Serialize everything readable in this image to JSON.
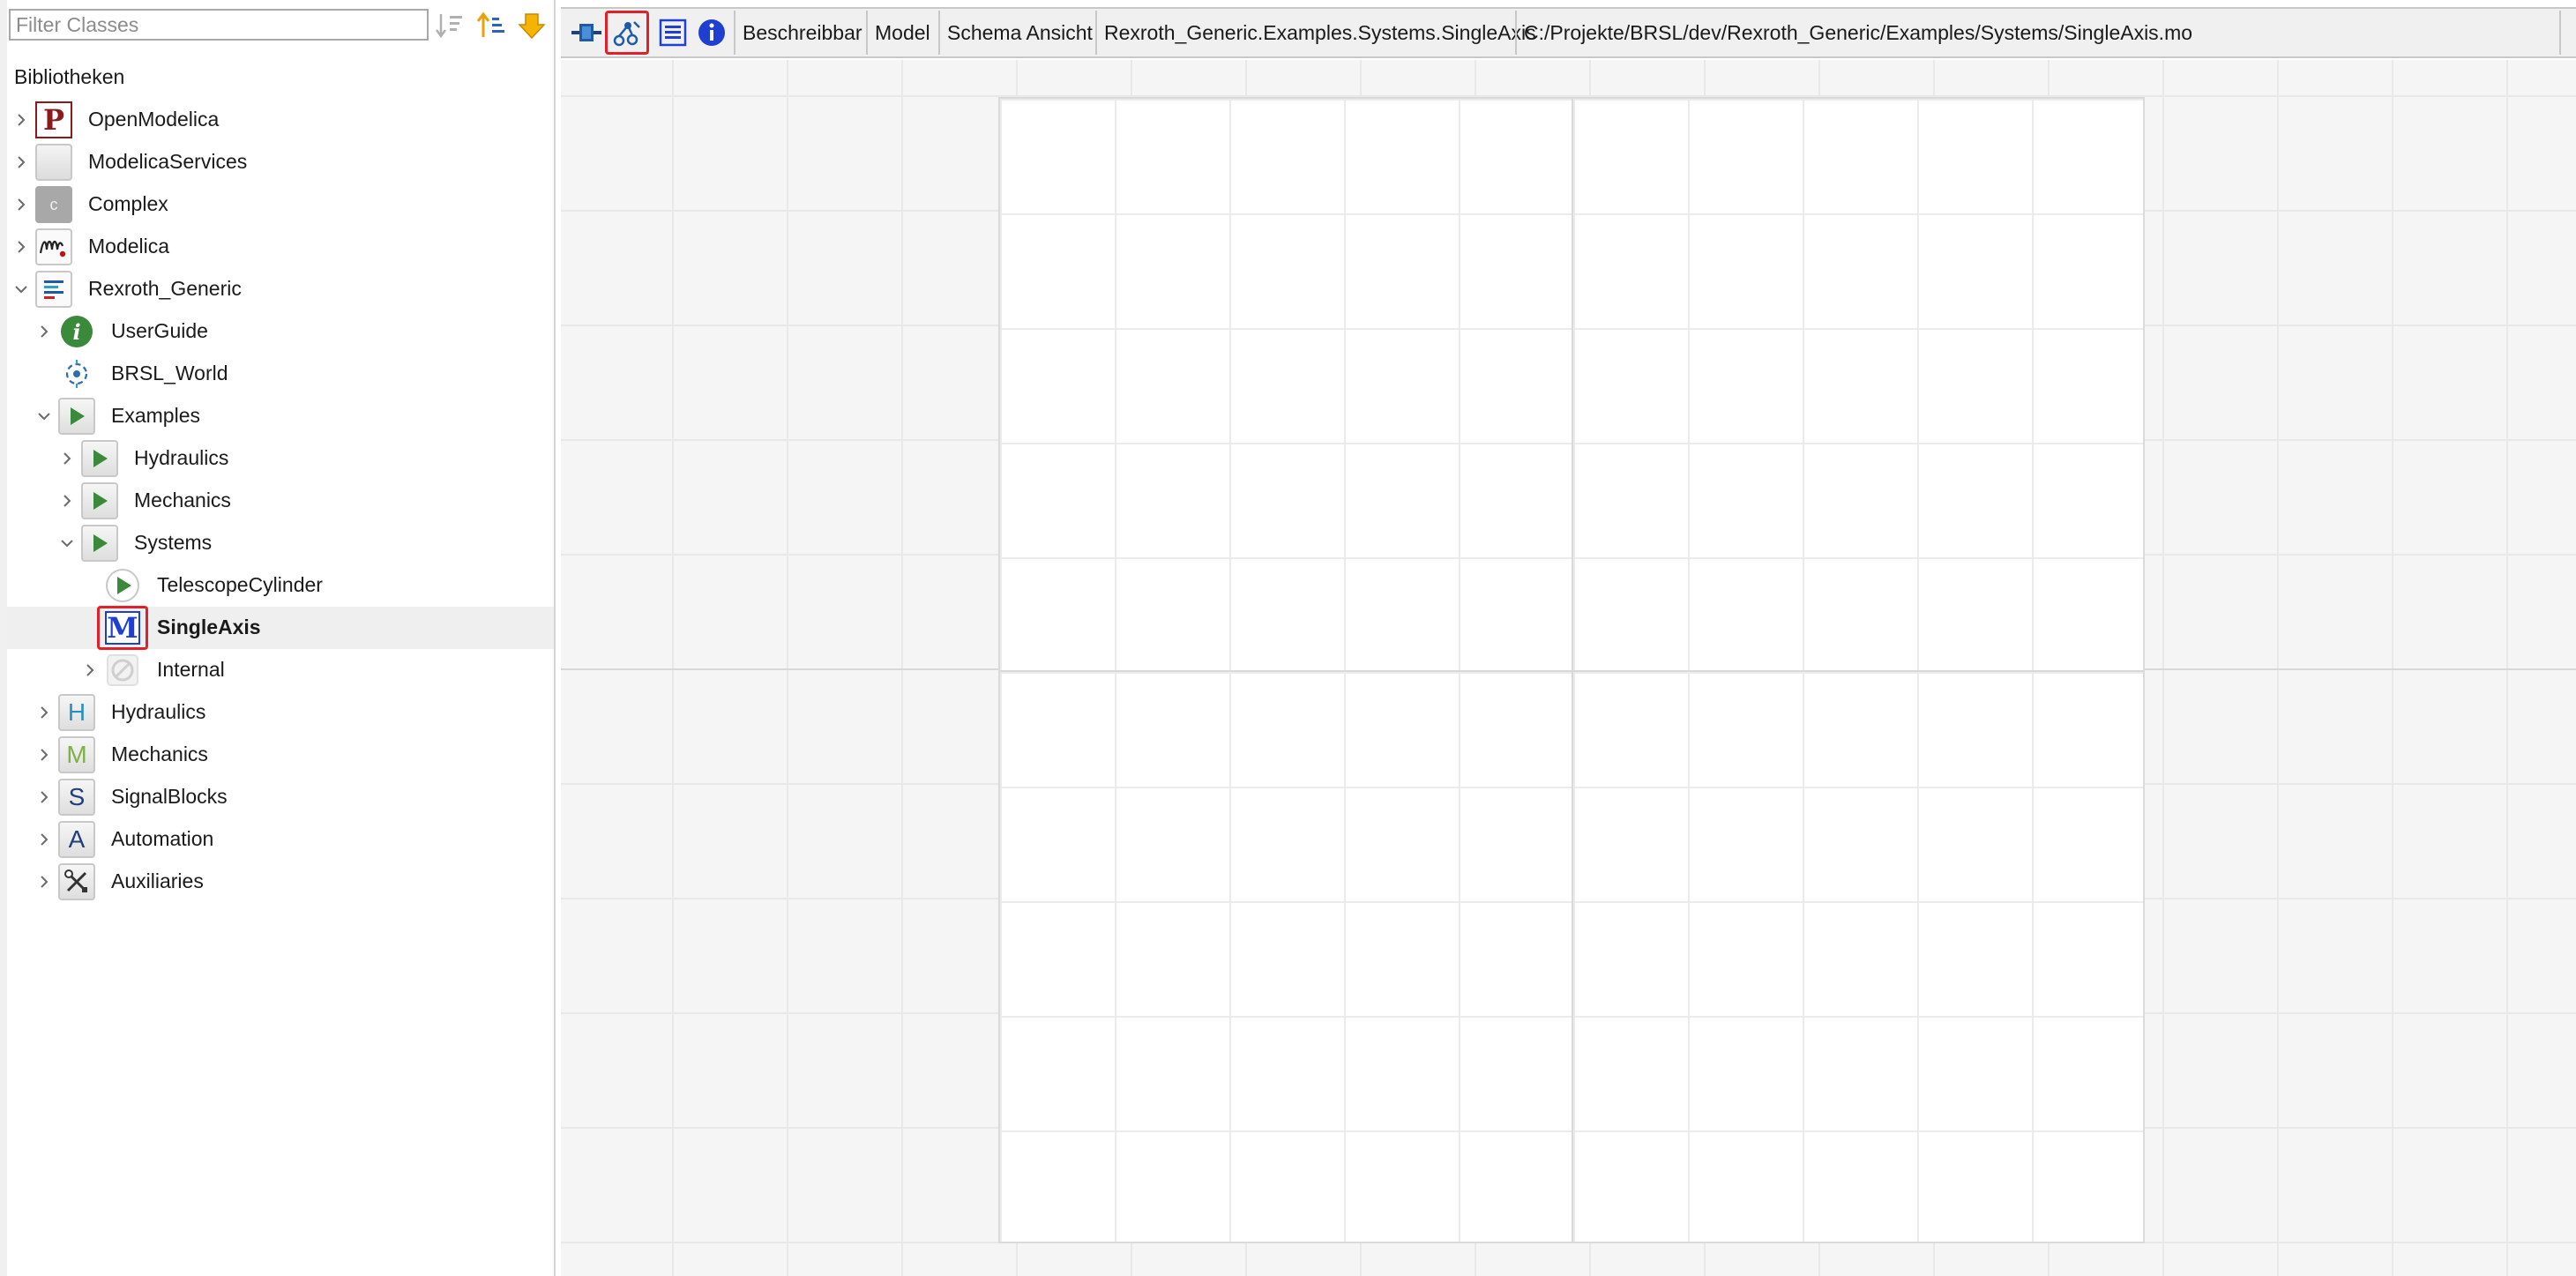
{
  "filter": {
    "placeholder": "Filter Classes"
  },
  "libraries_label": "Bibliotheken",
  "tree": {
    "openmodelica": "OpenModelica",
    "modelicaservices": "ModelicaServices",
    "complex": "Complex",
    "modelica": "Modelica",
    "rexroth_generic": "Rexroth_Generic",
    "userguide": "UserGuide",
    "brsl_world": "BRSL_World",
    "examples": "Examples",
    "ex_hydraulics": "Hydraulics",
    "ex_mechanics": "Mechanics",
    "systems": "Systems",
    "telescopecylinder": "TelescopeCylinder",
    "singleaxis": "SingleAxis",
    "internal": "Internal",
    "hydraulics": "Hydraulics",
    "mechanics": "Mechanics",
    "signalblocks": "SignalBlocks",
    "automation": "Automation",
    "auxiliaries": "Auxiliaries"
  },
  "tree_icon_letters": {
    "openmodelica": "P",
    "complex": "c",
    "singleaxis": "M",
    "hydraulics": "H",
    "mechanics": "M",
    "signalblocks": "S",
    "automation": "A"
  },
  "toolbar": {
    "status_writable": "Beschreibbar",
    "model_type": "Model",
    "view_name": "Schema Ansicht",
    "class_path": "Rexroth_Generic.Examples.Systems.SingleAxis",
    "file_path": "C:/Projekte/BRSL/dev/Rexroth_Generic/Examples/Systems/SingleAxis.mo"
  },
  "colors": {
    "highlight": "#e0202b",
    "modelica_blue": "#1f3fd0",
    "example_green": "#3b8a3b"
  }
}
